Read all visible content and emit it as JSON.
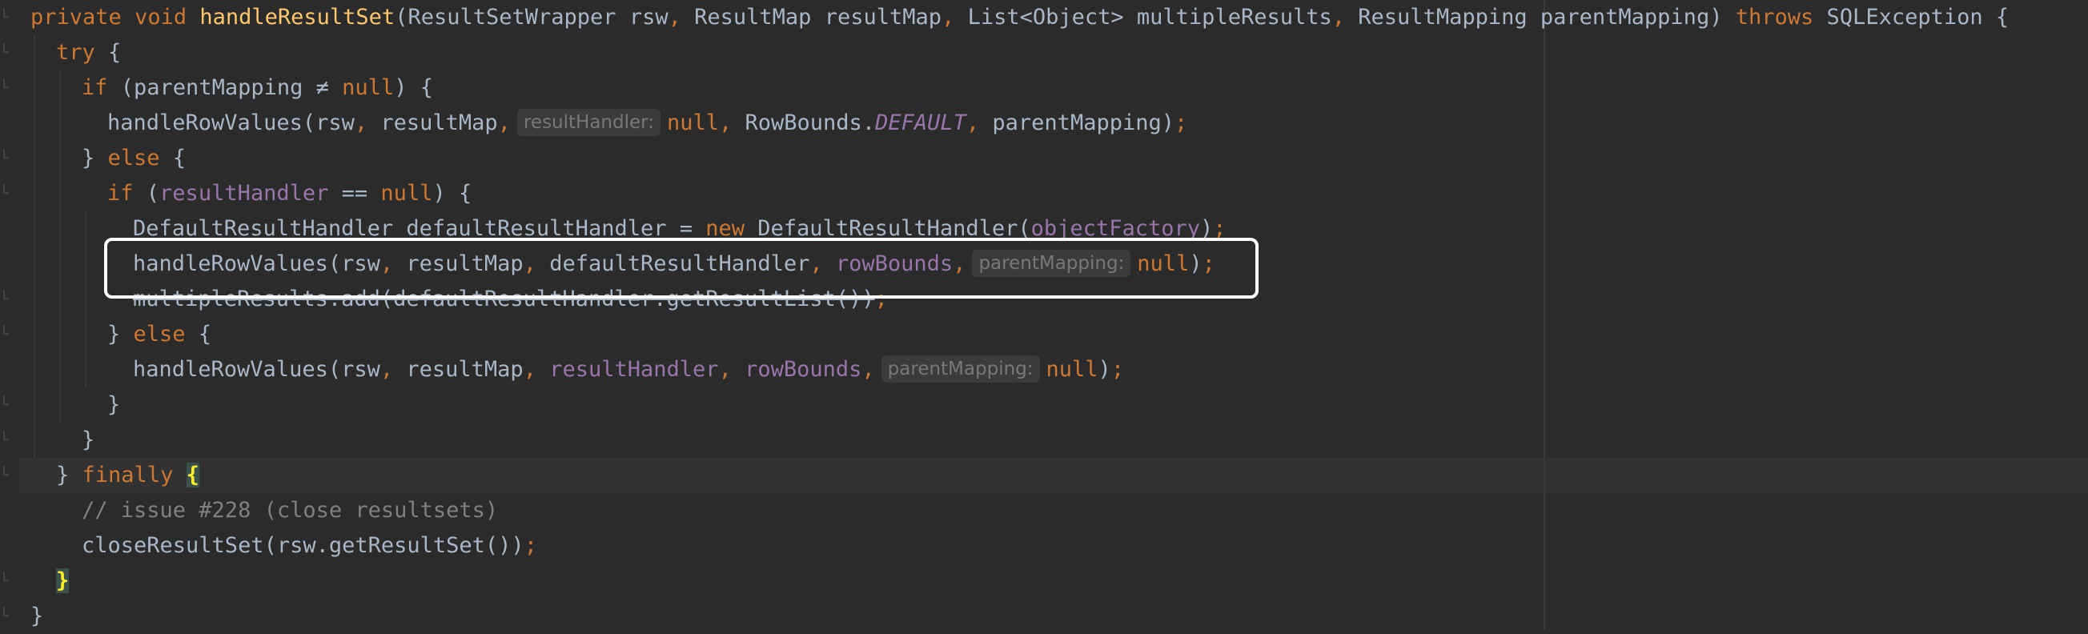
{
  "editor": {
    "language": "java",
    "colors": {
      "background": "#2b2b2b",
      "keyword": "#cc7832",
      "method_declaration": "#ffc66d",
      "plain": "#a9b7c6",
      "field": "#9876aa",
      "comment": "#808080",
      "inlay_hint_text": "#787878",
      "inlay_hint_background": "#3b3b3b",
      "matched_brace": "#ffef28",
      "annotation_box": "#ffffff"
    },
    "lines": {
      "l1": {
        "kw_private": "private",
        "kw_void": "void",
        "method_name": "handleResultSet",
        "open_paren": "(",
        "p1_type": "ResultSetWrapper",
        "p1_name": "rsw",
        "comma1": ",",
        "p2_type": "ResultMap",
        "p2_name": "resultMap",
        "comma2": ",",
        "p3_type": "List<Object>",
        "p3_name": "multipleResults",
        "comma3": ",",
        "p4_type": "ResultMapping",
        "p4_name": "parentMapping",
        "close_paren": ")",
        "kw_throws": "throws",
        "exception": "SQLException",
        "open_brace": "{"
      },
      "l2": {
        "kw_try": "try",
        "brace": "{"
      },
      "l3": {
        "kw_if": "if",
        "cond_open": "(parentMapping",
        "op_ne": "≠",
        "kw_null": "null",
        "cond_close": ") {"
      },
      "l4": {
        "call": "handleRowValues(rsw",
        "comma_a": ",",
        "arg_resultMap": "resultMap",
        "comma_b": ",",
        "hint": "resultHandler:",
        "kw_null": "null",
        "comma_c": ",",
        "rowbounds_cls": "RowBounds.",
        "rowbounds_default": "DEFAULT",
        "comma_d": ",",
        "arg_parent": "parentMapping)",
        "semi": ";"
      },
      "l5": {
        "close": "}",
        "kw_else": "else",
        "brace": "{"
      },
      "l6": {
        "kw_if": "if",
        "paren_open": "(",
        "field_resultHandler": "resultHandler",
        "op_eq": "==",
        "kw_null": "null",
        "cond_close": ") {"
      },
      "l7": {
        "decl": "DefaultResultHandler defaultResultHandler = ",
        "kw_new": "new",
        "ctor": " DefaultResultHandler(",
        "field_objectFactory": "objectFactory",
        "close": ")",
        "semi": ";"
      },
      "l8": {
        "call": "handleRowValues(rsw",
        "comma_a": ",",
        "arg_resultMap": "resultMap",
        "comma_b": ",",
        "arg_default": "defaultResultHandler",
        "comma_c": ",",
        "field_rowBounds": "rowBounds",
        "comma_d": ",",
        "hint": "parentMapping:",
        "kw_null": "null",
        "close": ")",
        "semi": ";"
      },
      "l9": {
        "text": "multipleResults.add(defaultResultHandler.getResultList())",
        "semi": ";"
      },
      "l10": {
        "close": "}",
        "kw_else": "else",
        "brace": "{"
      },
      "l11": {
        "call": "handleRowValues(rsw",
        "comma_a": ",",
        "arg_resultMap": "resultMap",
        "comma_b": ",",
        "field_resultHandler": "resultHandler",
        "comma_c": ",",
        "field_rowBounds": "rowBounds",
        "comma_d": ",",
        "hint": "parentMapping:",
        "kw_null": "null",
        "close": ")",
        "semi": ";"
      },
      "l12": {
        "close": "}"
      },
      "l13": {
        "close": "}"
      },
      "l14": {
        "close": "}",
        "kw_finally": "finally",
        "brace": "{"
      },
      "l15": {
        "comment": "// issue #228 (close resultsets)"
      },
      "l16": {
        "call": "closeResultSet(rsw.getResultSet())",
        "semi": ";"
      },
      "l17": {
        "close": "}"
      },
      "l18": {
        "close": "}"
      }
    }
  }
}
